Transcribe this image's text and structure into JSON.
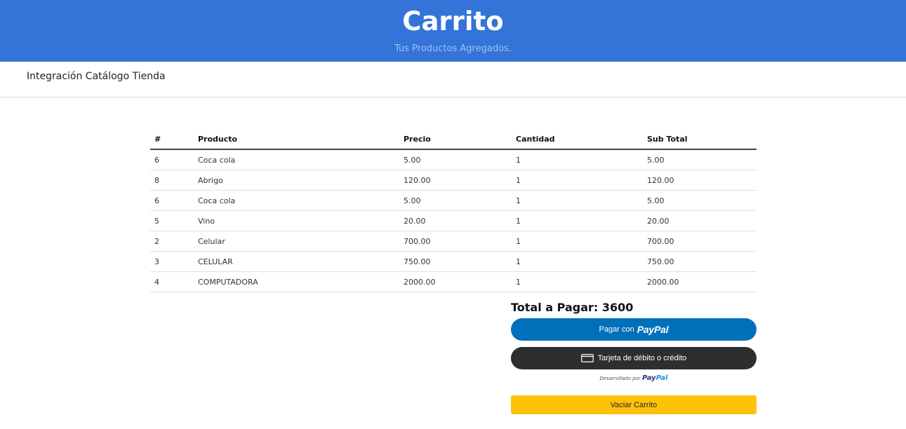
{
  "header": {
    "title": "Carrito",
    "subtitle": "Tus Productos Agregados."
  },
  "nav": {
    "brand": "Integración Catálogo Tienda"
  },
  "table": {
    "headers": [
      "#",
      "Producto",
      "Precio",
      "Cantidad",
      "Sub Total"
    ],
    "rows": [
      {
        "id": "6",
        "product": "Coca cola",
        "price": "5.00",
        "qty": "1",
        "subtotal": "5.00"
      },
      {
        "id": "8",
        "product": "Abrigo",
        "price": "120.00",
        "qty": "1",
        "subtotal": "120.00"
      },
      {
        "id": "6",
        "product": "Coca cola",
        "price": "5.00",
        "qty": "1",
        "subtotal": "5.00"
      },
      {
        "id": "5",
        "product": "Vino",
        "price": "20.00",
        "qty": "1",
        "subtotal": "20.00"
      },
      {
        "id": "2",
        "product": "Celular",
        "price": "700.00",
        "qty": "1",
        "subtotal": "700.00"
      },
      {
        "id": "3",
        "product": "CELULAR",
        "price": "750.00",
        "qty": "1",
        "subtotal": "750.00"
      },
      {
        "id": "4",
        "product": "COMPUTADORA",
        "price": "2000.00",
        "qty": "1",
        "subtotal": "2000.00"
      }
    ]
  },
  "summary": {
    "total_label": "Total a Pagar: 3600"
  },
  "payment": {
    "paypal_prefix": "Pagar con",
    "paypal_brand": "PayPal",
    "card_label": "Tarjeta de débito o crédito",
    "powered_prefix": "Desarrollado por",
    "powered_brand_pay": "Pay",
    "powered_brand_pal": "Pal"
  },
  "actions": {
    "empty_cart": "Vaciar Carrito"
  },
  "colors": {
    "header_bg": "#3474d8",
    "paypal_blue": "#0070ba",
    "card_dark": "#2c2e2f",
    "warning_yellow": "#ffc107"
  },
  "icons": {
    "card": "credit-card-icon"
  }
}
